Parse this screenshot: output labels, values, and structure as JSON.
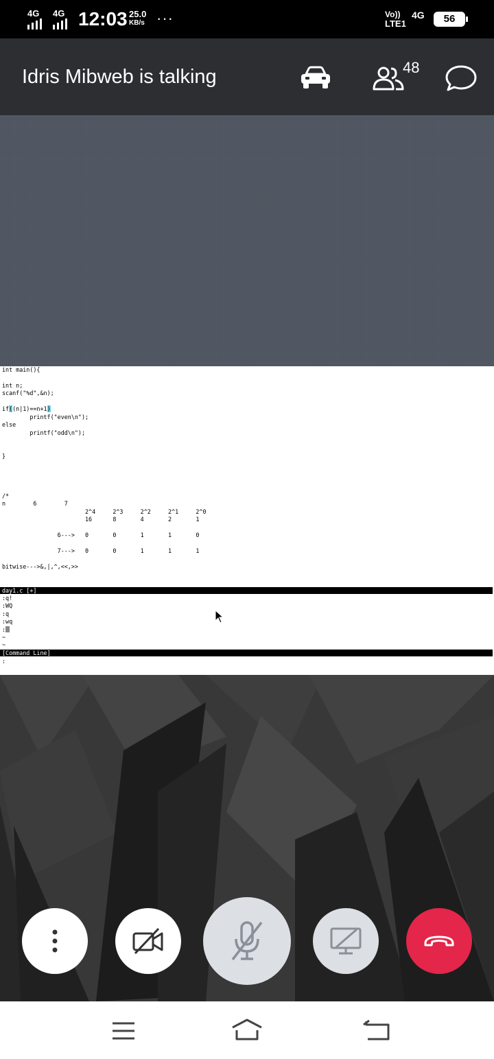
{
  "status_bar": {
    "network1": "4G",
    "network2": "4G",
    "time": "12:03",
    "speed_value": "25.0",
    "speed_unit": "KB/s",
    "more": "···",
    "volte_top": "Vo))",
    "volte_bottom": "LTE1",
    "network3": "4G",
    "battery": "56"
  },
  "header": {
    "title": "Idris Mibweb is talking",
    "participants_count": "48",
    "icons": [
      "car-mode-icon",
      "participants-icon",
      "chat-icon"
    ]
  },
  "shared_screen": {
    "lines": [
      "int main(){",
      "",
      "int n;",
      "scanf(\"%d\",&n);",
      "",
      "",
      "        printf(\"even\\n\");",
      "else",
      "        printf(\"odd\\n\");",
      "",
      "",
      "}",
      "",
      "",
      "",
      "",
      "/*",
      "n        6        7",
      "                        2^4     2^3     2^2     2^1     2^0",
      "                        16      8       4       2       1",
      "",
      "                6--->   0       0       1       1       0",
      "",
      "                7--->   0       0       1       1       1",
      "",
      "bitwise--->&,|,^,<<,>>"
    ],
    "if_line": {
      "prefix": "if",
      "open": "(",
      "middle": "(n|1)==n+1",
      "close": ")"
    },
    "file_status": "day1.c [+]",
    "history": [
      ":q!",
      ":WQ",
      ":q",
      ":wq"
    ],
    "prompt": ":",
    "tildes": [
      "~",
      "~"
    ],
    "command_line_label": "[Command Line]",
    "last_prompt": ":"
  },
  "controls": {
    "more": "more-options-icon",
    "camera": "camera-off-icon",
    "mic": "mic-off-icon",
    "share": "screen-share-off-icon",
    "end": "end-call-icon",
    "end_color": "#e3264a"
  },
  "nav": [
    "menu-icon",
    "home-icon",
    "back-icon"
  ]
}
